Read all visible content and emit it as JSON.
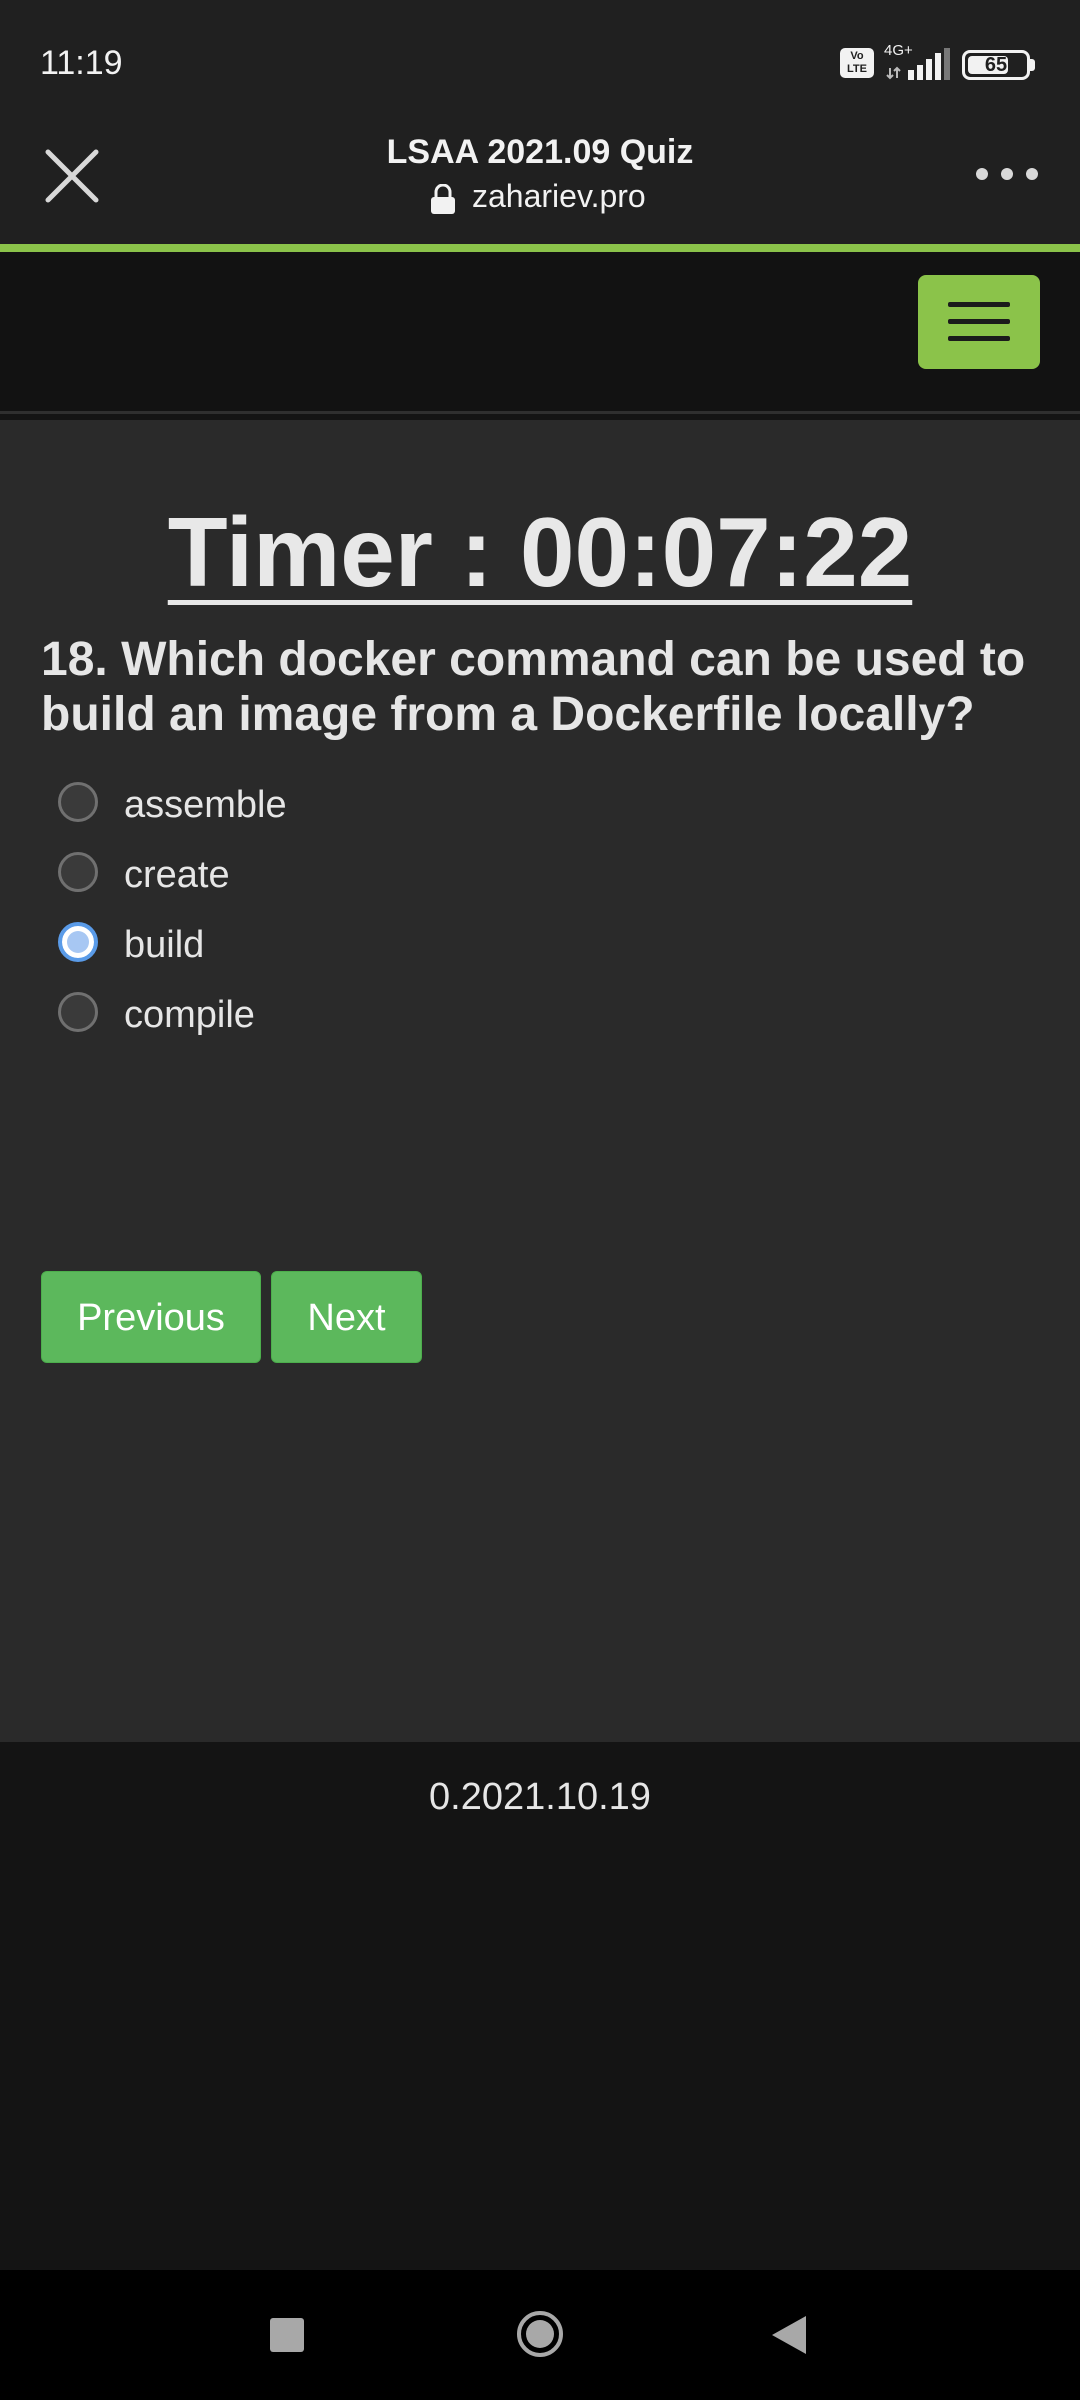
{
  "status_bar": {
    "time": "11:19",
    "volte_label": "Vo LTE",
    "network": "4G+",
    "battery_level": "65"
  },
  "browser": {
    "title": "LSAA 2021.09 Quiz",
    "domain": "zahariev.pro",
    "close_icon": "close-icon",
    "menu_icon": "more-horizontal-icon",
    "lock_icon": "lock-icon"
  },
  "site": {
    "menu_icon": "hamburger-icon",
    "accent_color": "#8bc34a"
  },
  "quiz": {
    "timer": "Timer : 00:07:22",
    "question": "18. Which docker command can be used to build an image from a Dockerfile locally?",
    "options": [
      {
        "label": "assemble",
        "selected": false
      },
      {
        "label": "create",
        "selected": false
      },
      {
        "label": "build",
        "selected": true
      },
      {
        "label": "compile",
        "selected": false
      }
    ],
    "previous_label": "Previous",
    "next_label": "Next",
    "button_color": "#5cb85c"
  },
  "footer": {
    "version": "0.2021.10.19"
  },
  "system_nav": {
    "recent_icon": "square-icon",
    "home_icon": "circle-icon",
    "back_icon": "triangle-back-icon"
  }
}
